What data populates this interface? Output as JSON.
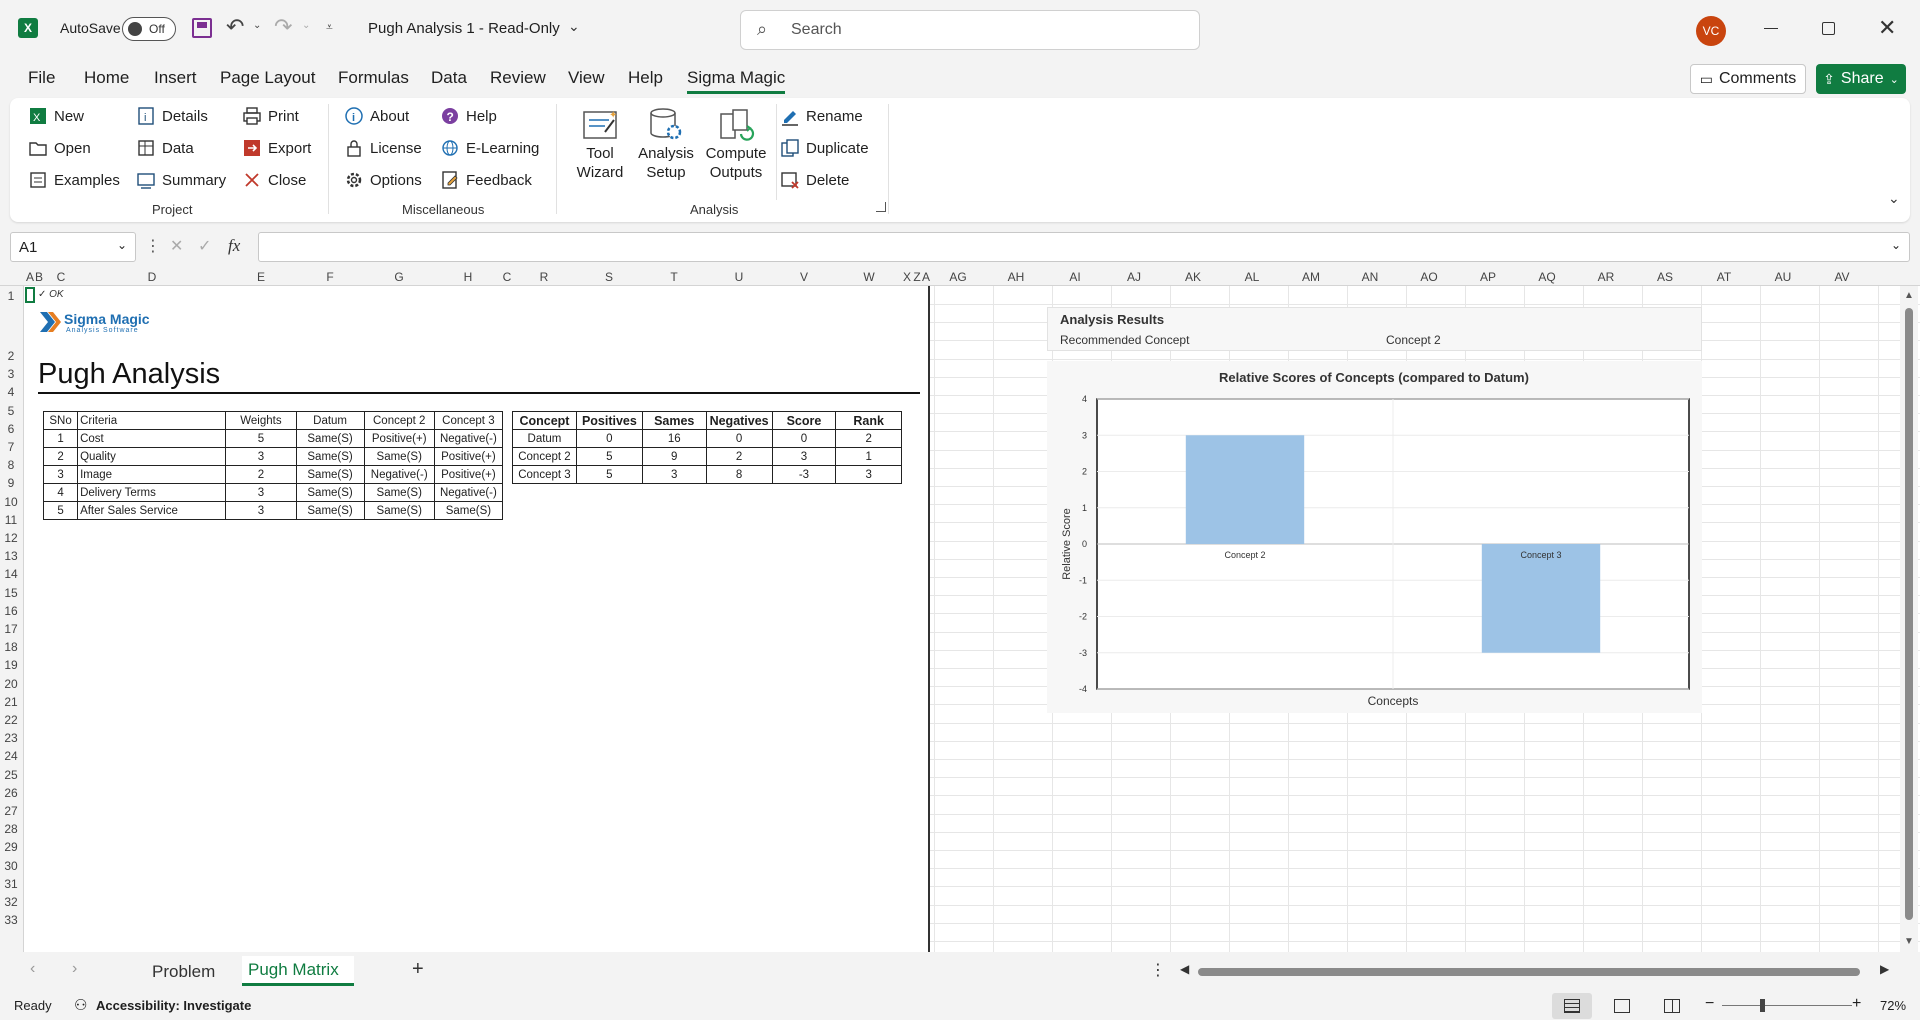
{
  "titlebar": {
    "autosave_label": "AutoSave",
    "autosave_state": "Off",
    "doc_title": "Pugh Analysis 1  -  Read-Only",
    "search_placeholder": "Search",
    "user_initials": "VC"
  },
  "menu": {
    "items": [
      "File",
      "Home",
      "Insert",
      "Page Layout",
      "Formulas",
      "Data",
      "Review",
      "View",
      "Help",
      "Sigma Magic"
    ],
    "active": "Sigma Magic",
    "comments_label": "Comments",
    "share_label": "Share"
  },
  "ribbon": {
    "project": {
      "new": "New",
      "open": "Open",
      "examples": "Examples",
      "details": "Details",
      "data": "Data",
      "summary": "Summary",
      "print": "Print",
      "export": "Export",
      "close": "Close",
      "label": "Project"
    },
    "misc": {
      "about": "About",
      "license": "License",
      "options": "Options",
      "help": "Help",
      "elearning": "E-Learning",
      "feedback": "Feedback",
      "label": "Miscellaneous"
    },
    "analysis": {
      "tool_wizard_1": "Tool",
      "tool_wizard_2": "Wizard",
      "analysis_setup_1": "Analysis",
      "analysis_setup_2": "Setup",
      "compute_1": "Compute",
      "compute_2": "Outputs",
      "rename": "Rename",
      "duplicate": "Duplicate",
      "delete": "Delete",
      "label": "Analysis"
    }
  },
  "formula": {
    "namebox": "A1",
    "fx": "fx",
    "value": ""
  },
  "sheet": {
    "columns": [
      "A",
      "B",
      "C",
      "D",
      "E",
      "F",
      "G",
      "H",
      "C",
      "R",
      "S",
      "T",
      "U",
      "V",
      "W",
      "X",
      "Z",
      "A",
      "AG",
      "AH",
      "AI",
      "AJ",
      "AK",
      "AL",
      "AM",
      "AN",
      "AO",
      "AP",
      "AQ",
      "AR",
      "AS",
      "AT",
      "AU",
      "AV"
    ],
    "rows": [
      "1",
      "2",
      "3",
      "4",
      "5",
      "6",
      "7",
      "8",
      "9",
      "10",
      "11",
      "12",
      "13",
      "14",
      "15",
      "16",
      "17",
      "18",
      "19",
      "20",
      "21",
      "22",
      "23",
      "24",
      "25",
      "26",
      "27",
      "28",
      "29",
      "30",
      "31",
      "32",
      "33"
    ],
    "ok_marker": "✓ OK",
    "logo_text": "Sigma Magic",
    "logo_sub": "Analysis Software",
    "title": "Pugh Analysis",
    "criteria_table": {
      "headers": [
        "SNo",
        "Criteria",
        "Weights",
        "Datum",
        "Concept 2",
        "Concept 3"
      ],
      "rows": [
        [
          "1",
          "Cost",
          "5",
          "Same(S)",
          "Positive(+)",
          "Negative(-)"
        ],
        [
          "2",
          "Quality",
          "3",
          "Same(S)",
          "Same(S)",
          "Positive(+)"
        ],
        [
          "3",
          "Image",
          "2",
          "Same(S)",
          "Negative(-)",
          "Positive(+)"
        ],
        [
          "4",
          "Delivery Terms",
          "3",
          "Same(S)",
          "Same(S)",
          "Negative(-)"
        ],
        [
          "5",
          "After Sales Service",
          "3",
          "Same(S)",
          "Same(S)",
          "Same(S)"
        ]
      ]
    },
    "summary_table": {
      "headers": [
        "Concept",
        "Positives",
        "Sames",
        "Negatives",
        "Score",
        "Rank"
      ],
      "rows": [
        [
          "Datum",
          "0",
          "16",
          "0",
          "0",
          "2"
        ],
        [
          "Concept 2",
          "5",
          "9",
          "2",
          "3",
          "1"
        ],
        [
          "Concept 3",
          "5",
          "3",
          "8",
          "-3",
          "3"
        ]
      ]
    },
    "results": {
      "title": "Analysis Results",
      "label": "Recommended Concept",
      "value": "Concept 2"
    }
  },
  "chart_data": {
    "type": "bar",
    "title": "Relative Scores of Concepts (compared to Datum)",
    "xlabel": "Concepts",
    "ylabel": "Relative Score",
    "categories": [
      "Concept 2",
      "Concept 3"
    ],
    "values": [
      3,
      -3
    ],
    "ylim": [
      -4,
      4
    ],
    "yticks": [
      "4",
      "3",
      "2",
      "1",
      "0",
      "-1",
      "-2",
      "-3",
      "-4"
    ],
    "bar_color": "#9dc3e6",
    "grid": true
  },
  "tabs": {
    "items": [
      "Problem",
      "Pugh Matrix"
    ],
    "active": "Pugh Matrix",
    "add": "+"
  },
  "status": {
    "ready": "Ready",
    "accessibility": "Accessibility: Investigate",
    "zoom": "72%"
  }
}
